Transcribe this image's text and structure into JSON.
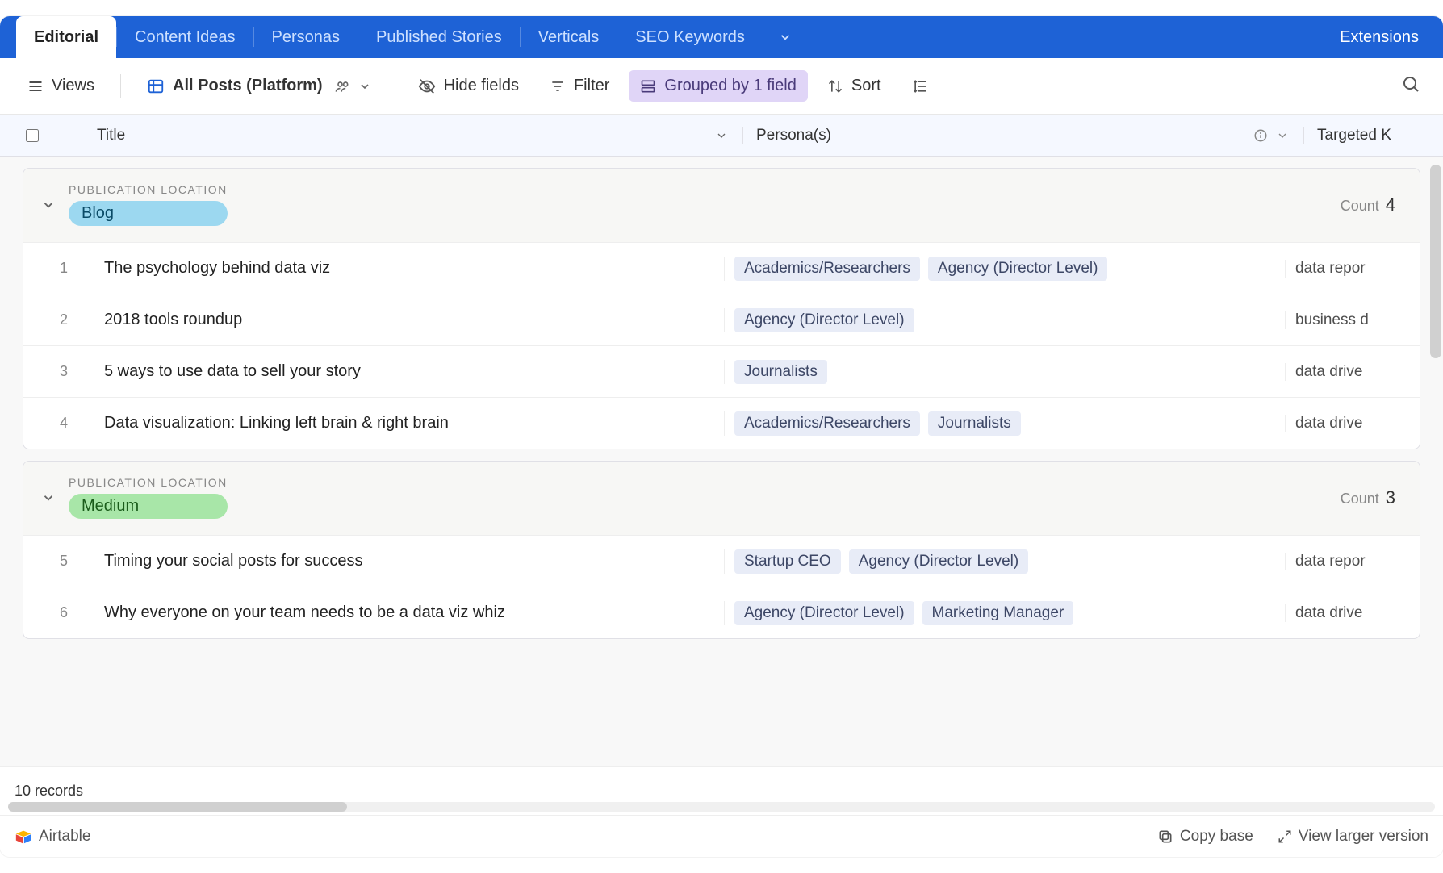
{
  "tabs": {
    "items": [
      "Editorial",
      "Content Ideas",
      "Personas",
      "Published Stories",
      "Verticals",
      "SEO Keywords"
    ],
    "active_index": 0,
    "extensions": "Extensions"
  },
  "toolbar": {
    "views": "Views",
    "view_name": "All Posts (Platform)",
    "hide_fields": "Hide fields",
    "filter": "Filter",
    "grouped": "Grouped by 1 field",
    "sort": "Sort"
  },
  "columns": {
    "title": "Title",
    "personas": "Persona(s)",
    "keywords": "Targeted K"
  },
  "groups": [
    {
      "label": "PUBLICATION LOCATION",
      "value": "Blog",
      "pill_class": "blue",
      "count_label": "Count",
      "count": "4",
      "rows": [
        {
          "n": "1",
          "title": "The psychology behind data viz",
          "personas": [
            "Academics/Researchers",
            "Agency (Director Level)"
          ],
          "key": "data repor"
        },
        {
          "n": "2",
          "title": "2018 tools roundup",
          "personas": [
            "Agency (Director Level)"
          ],
          "key": "business d"
        },
        {
          "n": "3",
          "title": "5 ways to use data to sell your story",
          "personas": [
            "Journalists"
          ],
          "key": "data drive"
        },
        {
          "n": "4",
          "title": "Data visualization: Linking left brain & right brain",
          "personas": [
            "Academics/Researchers",
            "Journalists"
          ],
          "key": "data drive"
        }
      ]
    },
    {
      "label": "PUBLICATION LOCATION",
      "value": "Medium",
      "pill_class": "green",
      "count_label": "Count",
      "count": "3",
      "rows": [
        {
          "n": "5",
          "title": "Timing your social posts for success",
          "personas": [
            "Startup CEO",
            "Agency (Director Level)"
          ],
          "key": "data repor"
        },
        {
          "n": "6",
          "title": "Why everyone on your team needs to be a data viz whiz",
          "personas": [
            "Agency (Director Level)",
            "Marketing Manager"
          ],
          "key": "data drive"
        }
      ]
    }
  ],
  "status": {
    "records": "10 records"
  },
  "footer": {
    "brand": "Airtable",
    "copy_base": "Copy base",
    "view_larger": "View larger version"
  }
}
